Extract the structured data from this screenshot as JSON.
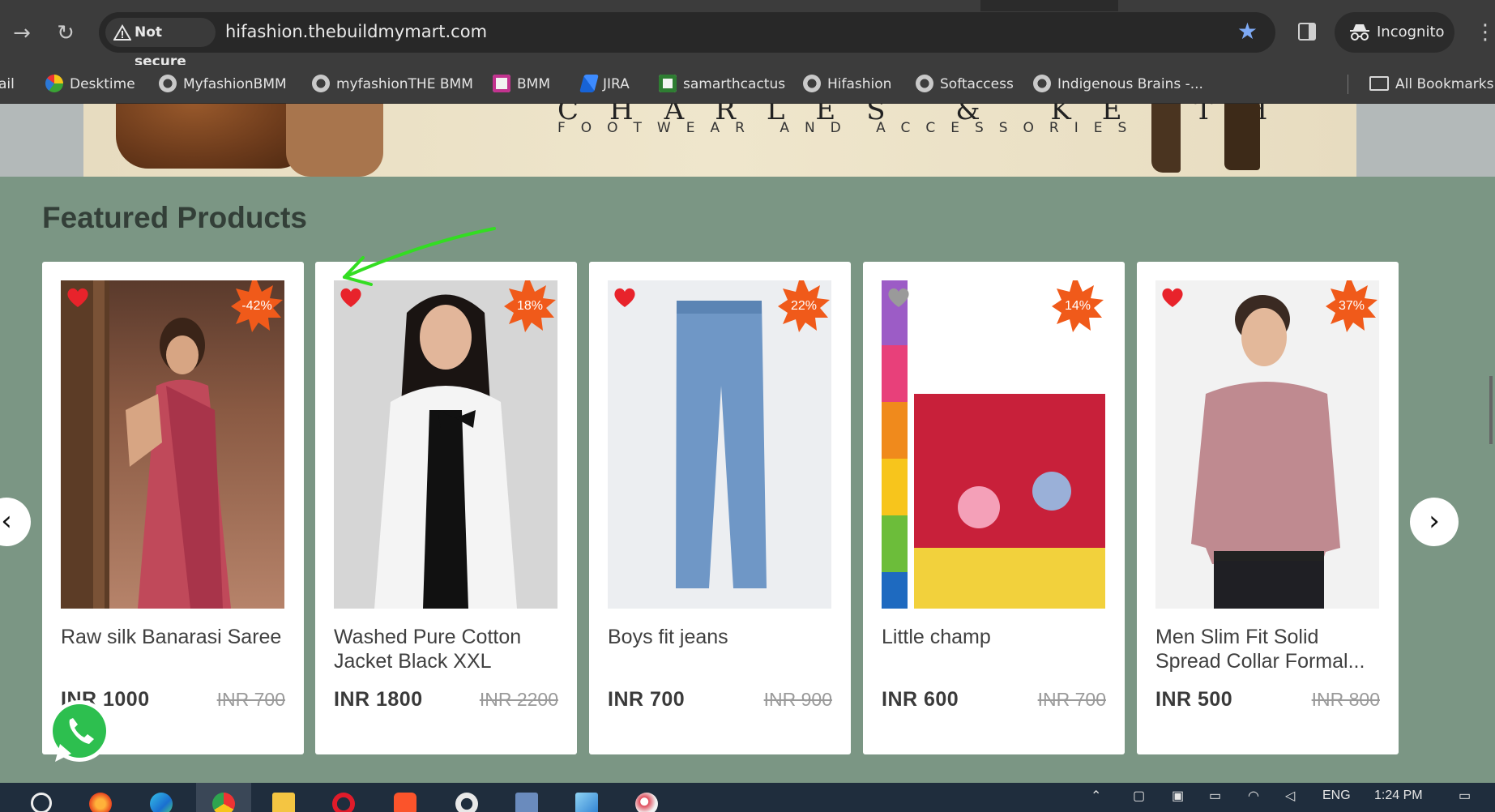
{
  "browser": {
    "security_label": "Not secure",
    "url": "hifashion.thebuildmymart.com",
    "incognito_label": "Incognito",
    "bookmarks": [
      {
        "label": "ail",
        "icon": "mail-icon"
      },
      {
        "label": "Desktime",
        "icon": "desktime-icon"
      },
      {
        "label": "MyfashionBMM",
        "icon": "globe-icon"
      },
      {
        "label": "myfashionTHE BMM",
        "icon": "globe-icon"
      },
      {
        "label": "BMM",
        "icon": "bmm-icon"
      },
      {
        "label": "JIRA",
        "icon": "jira-icon"
      },
      {
        "label": "samarthcactus",
        "icon": "cactus-icon"
      },
      {
        "label": "Hifashion",
        "icon": "globe-icon"
      },
      {
        "label": "Softaccess",
        "icon": "globe-icon"
      },
      {
        "label": "Indigenous Brains -...",
        "icon": "globe-icon"
      }
    ],
    "all_bookmarks_label": "All Bookmarks"
  },
  "banner": {
    "brand": "CHARLES & KEITH",
    "tagline": "FOOTWEAR AND ACCESSORIES"
  },
  "section": {
    "title": "Featured Products"
  },
  "products": [
    {
      "name": "Raw silk Banarasi Saree",
      "price": "INR 1000",
      "old_price": "INR 700",
      "discount": "-42%",
      "heart_color": "#e8232b"
    },
    {
      "name": "Washed Pure Cotton Jacket Black XXL",
      "price": "INR 1800",
      "old_price": "INR 2200",
      "discount": "18%",
      "heart_color": "#e8232b"
    },
    {
      "name": "Boys fit jeans",
      "price": "INR 700",
      "old_price": "INR 900",
      "discount": "22%",
      "heart_color": "#e8232b"
    },
    {
      "name": "Little champ",
      "price": "INR 600",
      "old_price": "INR 700",
      "discount": "14%",
      "heart_color": "#9a9a9a"
    },
    {
      "name": "Men Slim Fit Solid Spread Collar Formal...",
      "price": "INR 500",
      "old_price": "INR 800",
      "discount": "37%",
      "heart_color": "#e8232b"
    }
  ],
  "carousel": {
    "prev_glyph": "‹",
    "next_glyph": "›"
  },
  "taskbar": {
    "language": "ENG",
    "time": "1:24 PM"
  },
  "colors": {
    "page_bg": "#7b9684",
    "badge": "#f05a1a",
    "heart": "#e8232b",
    "annotation_arrow": "#33dd22"
  }
}
